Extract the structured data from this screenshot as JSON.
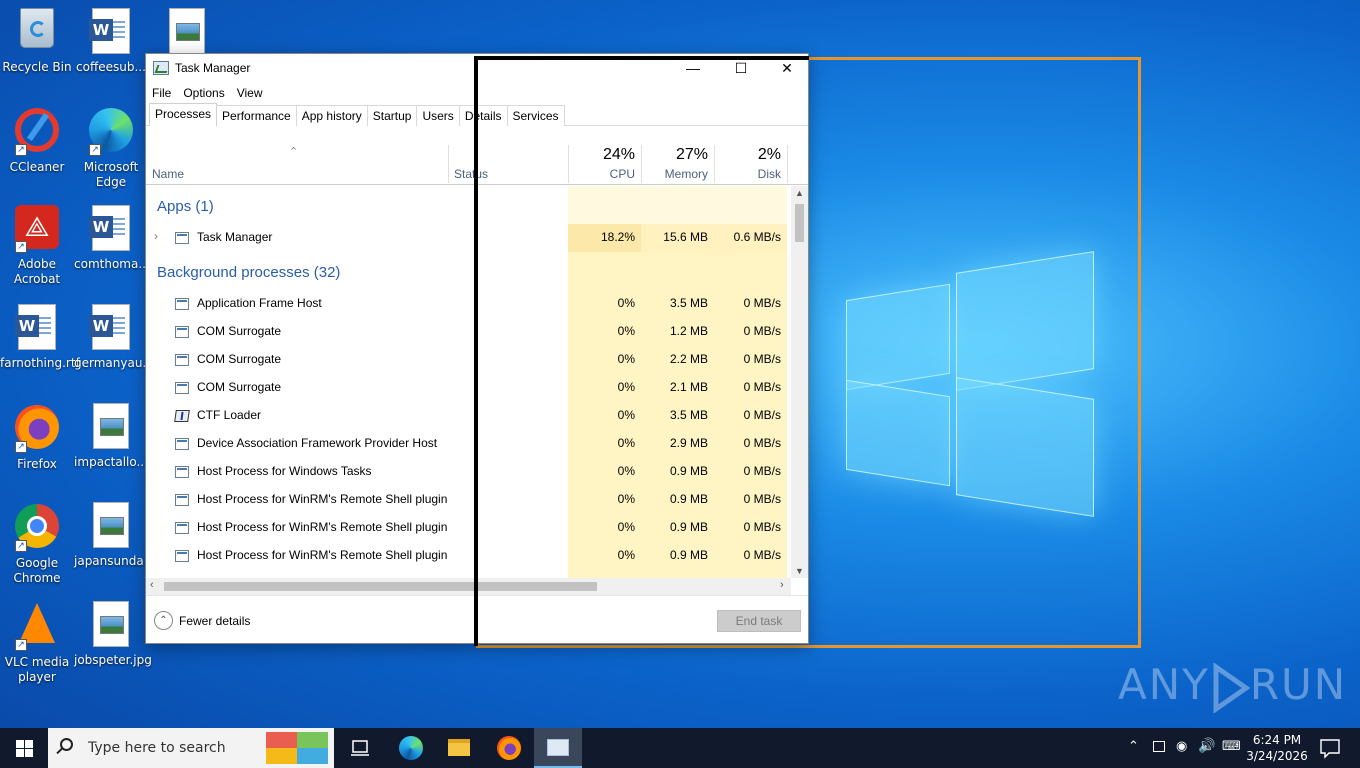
{
  "desktop": {
    "icons": [
      {
        "label": "Recycle Bin"
      },
      {
        "label": "coffeesub..."
      },
      {
        "label": "CCleaner"
      },
      {
        "label": "Microsoft Edge"
      },
      {
        "label": "Adobe Acrobat"
      },
      {
        "label": "comthoma..."
      },
      {
        "label": "farnothing.rtf"
      },
      {
        "label": "germanyau..."
      },
      {
        "label": "Firefox"
      },
      {
        "label": "impactallo..."
      },
      {
        "label": "Google Chrome"
      },
      {
        "label": "japansunda..."
      },
      {
        "label": "VLC media player"
      },
      {
        "label": "jobspeter.jpg"
      }
    ]
  },
  "task_manager": {
    "title": "Task Manager",
    "window_controls": {
      "minimize": "—",
      "maximize": "☐",
      "close": "✕"
    },
    "menu": [
      "File",
      "Options",
      "View"
    ],
    "tabs": [
      "Processes",
      "Performance",
      "App history",
      "Startup",
      "Users",
      "Details",
      "Services"
    ],
    "active_tab": "Processes",
    "columns": {
      "name": "Name",
      "status": "Status",
      "cpu": {
        "pct": "24%",
        "label": "CPU"
      },
      "memory": {
        "pct": "27%",
        "label": "Memory"
      },
      "disk": {
        "pct": "2%",
        "label": "Disk"
      }
    },
    "apps_group": "Apps (1)",
    "apps": [
      {
        "name": "Task Manager",
        "cpu": "18.2%",
        "memory": "15.6 MB",
        "disk": "0.6 MB/s"
      }
    ],
    "bg_group": "Background processes (32)",
    "background": [
      {
        "name": "Application Frame Host",
        "cpu": "0%",
        "memory": "3.5 MB",
        "disk": "0 MB/s"
      },
      {
        "name": "COM Surrogate",
        "cpu": "0%",
        "memory": "1.2 MB",
        "disk": "0 MB/s"
      },
      {
        "name": "COM Surrogate",
        "cpu": "0%",
        "memory": "2.2 MB",
        "disk": "0 MB/s"
      },
      {
        "name": "COM Surrogate",
        "cpu": "0%",
        "memory": "2.1 MB",
        "disk": "0 MB/s"
      },
      {
        "name": "CTF Loader",
        "cpu": "0%",
        "memory": "3.5 MB",
        "disk": "0 MB/s"
      },
      {
        "name": "Device Association Framework Provider Host",
        "cpu": "0%",
        "memory": "2.9 MB",
        "disk": "0 MB/s"
      },
      {
        "name": "Host Process for Windows Tasks",
        "cpu": "0%",
        "memory": "0.9 MB",
        "disk": "0 MB/s"
      },
      {
        "name": "Host Process for WinRM's Remote Shell plugin",
        "cpu": "0%",
        "memory": "0.9 MB",
        "disk": "0 MB/s"
      },
      {
        "name": "Host Process for WinRM's Remote Shell plugin",
        "cpu": "0%",
        "memory": "0.9 MB",
        "disk": "0 MB/s"
      },
      {
        "name": "Host Process for WinRM's Remote Shell plugin",
        "cpu": "0%",
        "memory": "0.9 MB",
        "disk": "0 MB/s"
      }
    ],
    "fewer_details": "Fewer details",
    "end_task": "End task"
  },
  "taskbar": {
    "search_placeholder": "Type here to search",
    "time": "6:24 PM",
    "date": "3/24/2026"
  },
  "watermark": {
    "left": "ANY",
    "right": "RUN"
  },
  "colors": {
    "heat_light": "#fff9e0",
    "heat_cpu_hot": "#fce8a8",
    "heat_cell": "#fff4c4",
    "accent_group": "#2a5ea8",
    "overlay_frame": "#e8962b"
  }
}
